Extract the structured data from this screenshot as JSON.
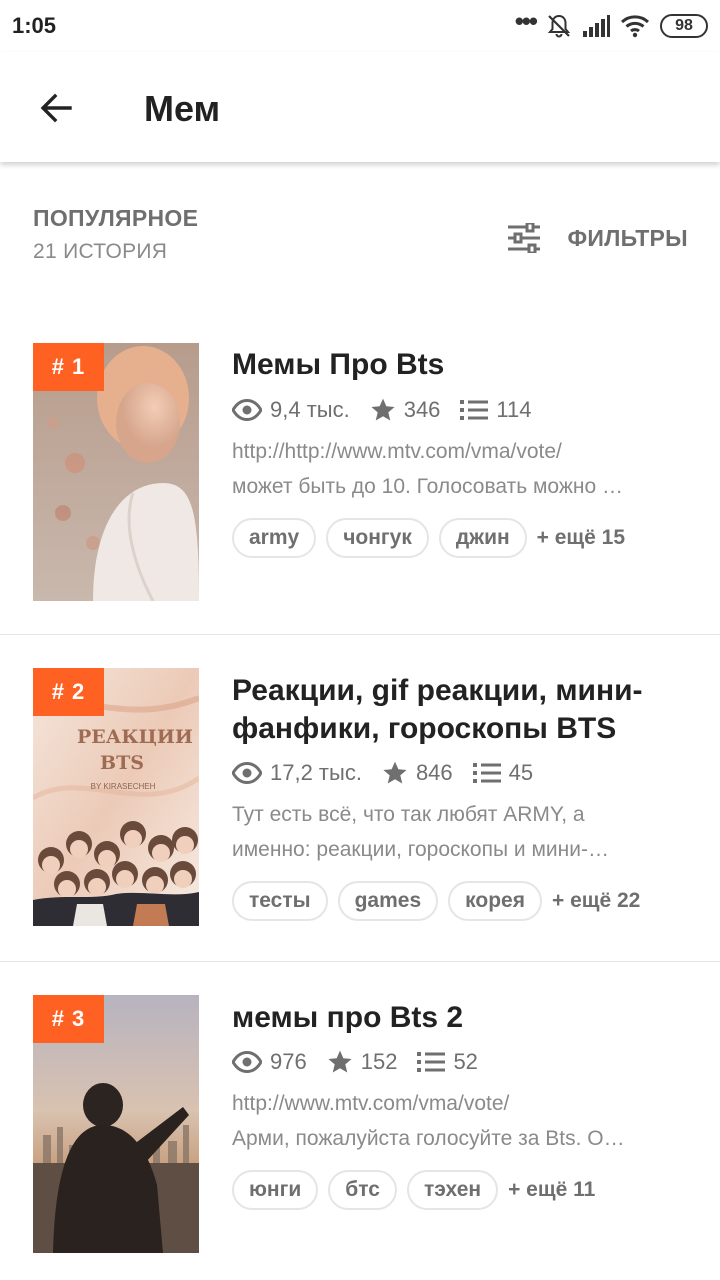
{
  "status": {
    "time": "1:05",
    "battery": "98"
  },
  "header": {
    "title": "Мем"
  },
  "section": {
    "title": "ПОПУЛЯРНОЕ",
    "count": "21 ИСТОРИЯ",
    "filters_label": "ФИЛЬТРЫ"
  },
  "stories": [
    {
      "rank": "# 1",
      "title": "Мемы Про Bts",
      "views": "9,4 тыс.",
      "stars": "346",
      "parts": "114",
      "desc1": "http://http://www.mtv.com/vma/vote/",
      "desc2": "может быть до 10. Голосовать можно …",
      "tags": [
        "army",
        "чонгук",
        "джин"
      ],
      "more": "+ ещё 15"
    },
    {
      "rank": "# 2",
      "title": "Реакции, gif реакции, мини-фанфики, гороскопы BTS",
      "cover_text": "РЕАКЦИИ BTS",
      "cover_sub": "BY KIRASECHEH",
      "views": "17,2 тыс.",
      "stars": "846",
      "parts": "45",
      "desc1": "Тут есть всё, что так любят ARMY, а",
      "desc2": "именно: реакции, гороскопы и мини-…",
      "tags": [
        "тесты",
        "games",
        "корея"
      ],
      "more": "+ ещё 22"
    },
    {
      "rank": "# 3",
      "title": "мемы про Bts 2",
      "views": "976",
      "stars": "152",
      "parts": "52",
      "desc1": "http://www.mtv.com/vma/vote/",
      "desc2": "Арми, пожалуйста голосуйте за Bts. О…",
      "tags": [
        "юнги",
        "бтс",
        "тэхен"
      ],
      "more": "+ ещё 11"
    }
  ]
}
